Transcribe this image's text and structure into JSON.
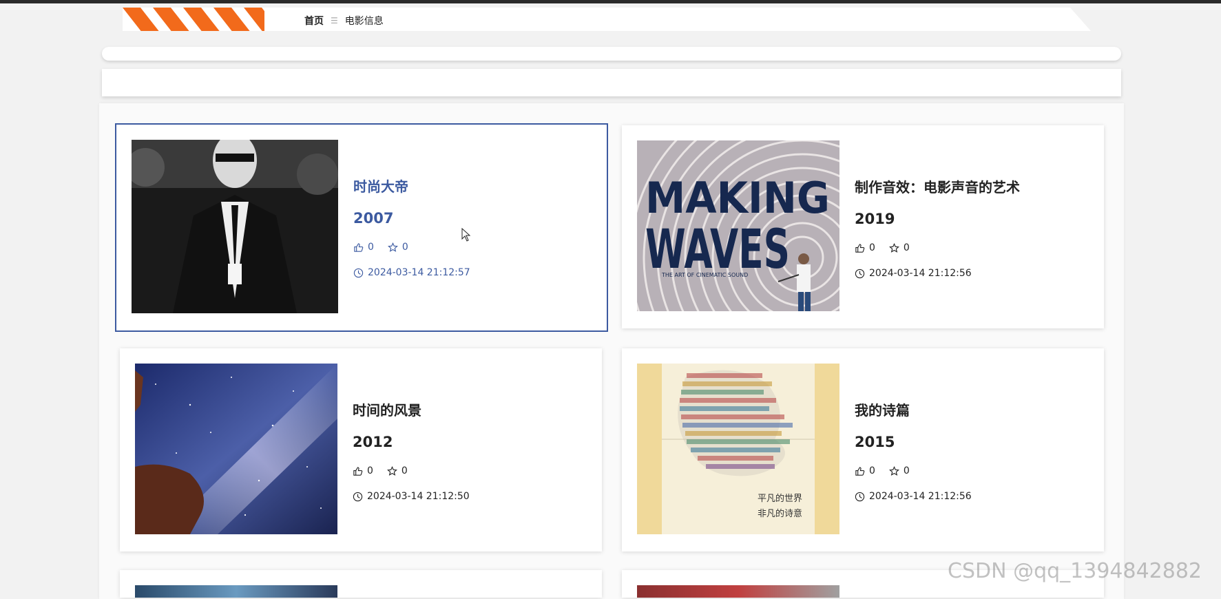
{
  "breadcrumb": {
    "home": "首页",
    "separator": "☰",
    "current": "电影信息"
  },
  "movies": [
    {
      "title": "时尚大帝",
      "year": "2007",
      "likes": "0",
      "favorites": "0",
      "time": "2024-03-14 21:12:57",
      "active": true
    },
    {
      "title": "制作音效：电影声音的艺术",
      "year": "2019",
      "likes": "0",
      "favorites": "0",
      "time": "2024-03-14 21:12:56",
      "poster_text": {
        "line1": "MAKING",
        "line2": "WAVES",
        "tagline": "THE ART OF CINEMATIC SOUND"
      }
    },
    {
      "title": "时间的风景",
      "year": "2012",
      "likes": "0",
      "favorites": "0",
      "time": "2024-03-14 21:12:50"
    },
    {
      "title": "我的诗篇",
      "year": "2015",
      "likes": "0",
      "favorites": "0",
      "time": "2024-03-14 21:12:56",
      "poster_text": {
        "line1": "平凡的世界",
        "line2": "非凡的诗意"
      }
    }
  ],
  "watermark": "CSDN @qq_1394842882",
  "colors": {
    "accent": "#3c5aa0",
    "stripe": "#f26a1b"
  }
}
